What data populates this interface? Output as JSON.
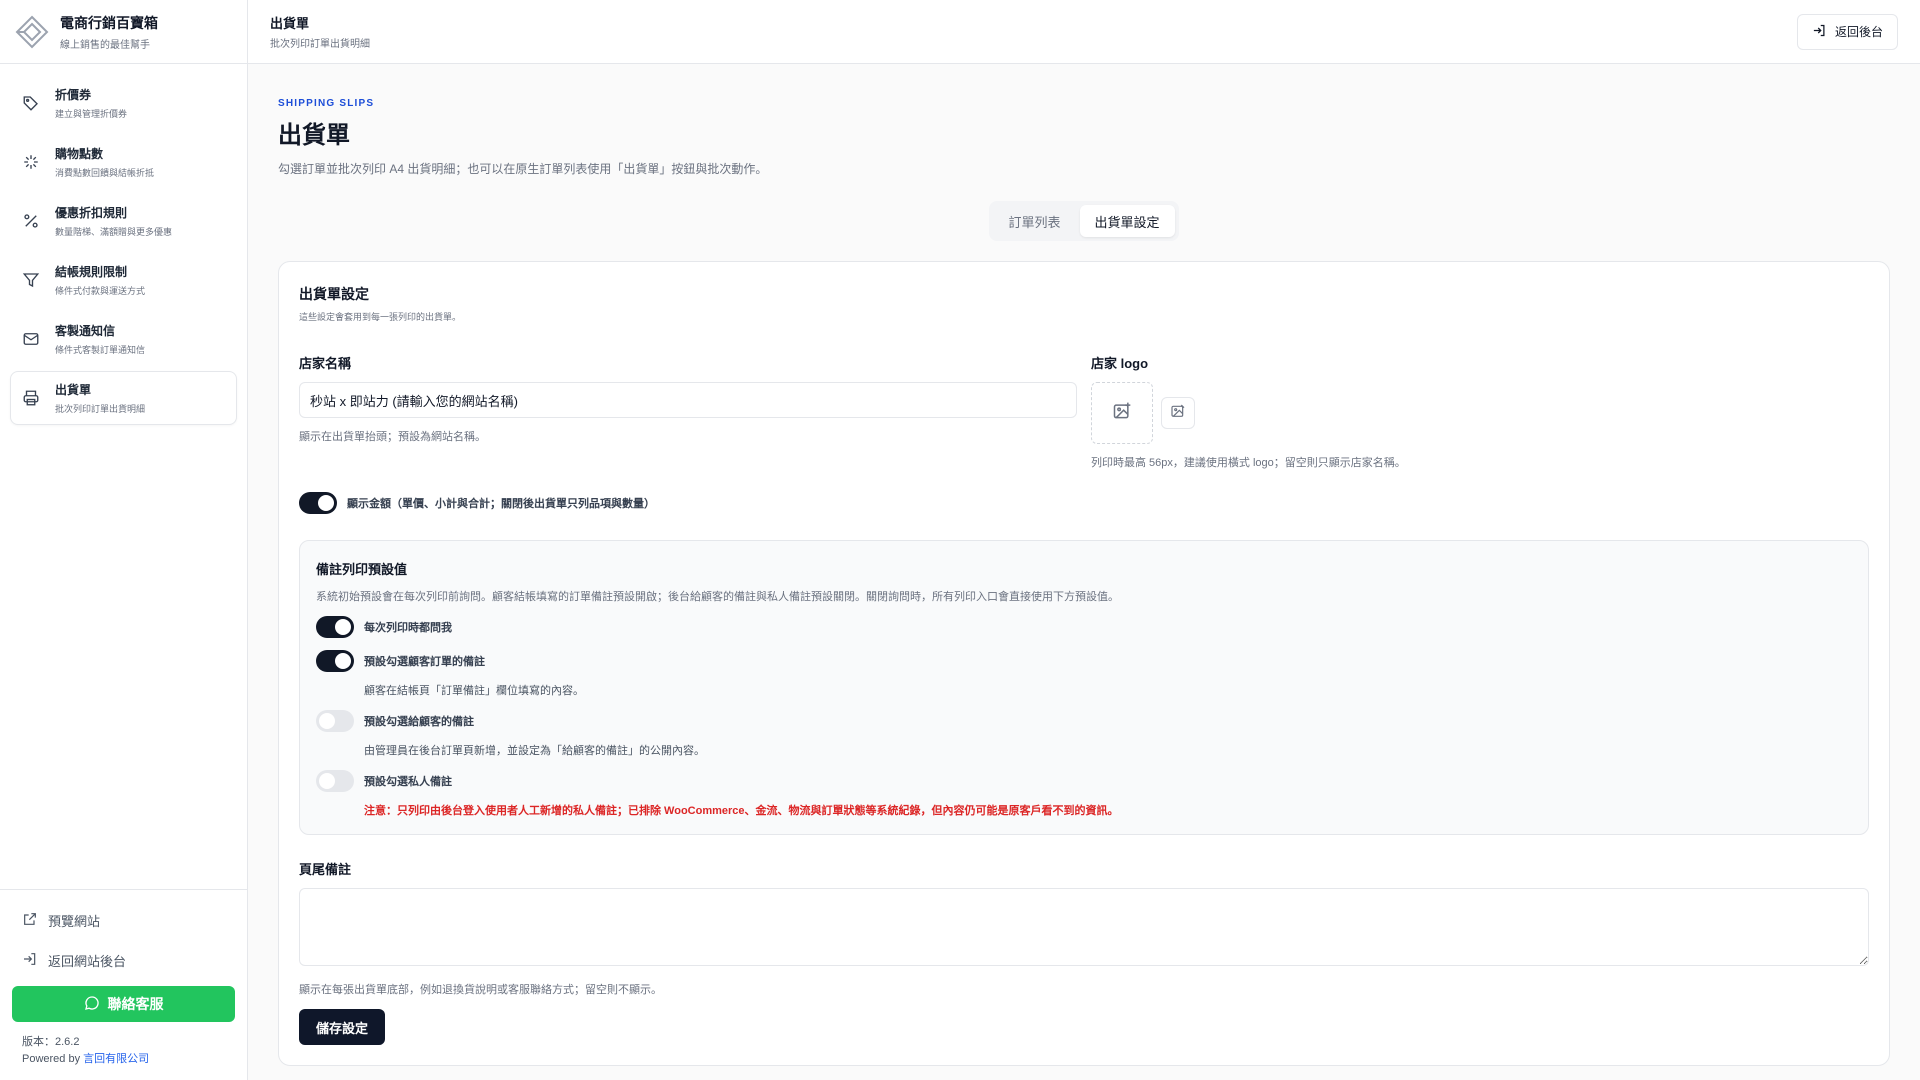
{
  "brand": {
    "title": "電商行銷百寶箱",
    "subtitle": "線上銷售的最佳幫手"
  },
  "sidebar": {
    "items": [
      {
        "icon": "tag-icon",
        "title": "折價券",
        "desc": "建立與管理折價券"
      },
      {
        "icon": "sparkle-icon",
        "title": "購物點數",
        "desc": "消費點數回饋與結帳折抵"
      },
      {
        "icon": "percent-icon",
        "title": "優惠折扣規則",
        "desc": "數量階梯、滿額贈與更多優惠"
      },
      {
        "icon": "filter-icon",
        "title": "結帳規則限制",
        "desc": "條件式付款與運送方式"
      },
      {
        "icon": "mail-icon",
        "title": "客製通知信",
        "desc": "條件式客製訂單通知信"
      },
      {
        "icon": "printer-icon",
        "title": "出貨單",
        "desc": "批次列印訂單出貨明細"
      }
    ],
    "preview_site": "預覽網站",
    "back_to_admin": "返回網站後台",
    "contact": "聯絡客服",
    "version": "版本：2.6.2",
    "powered_by": "Powered by",
    "company": "言回有限公司"
  },
  "topbar": {
    "title": "出貨單",
    "subtitle": "批次列印訂單出貨明細",
    "back_button": "返回後台"
  },
  "page": {
    "eyebrow": "SHIPPING SLIPS",
    "title": "出貨單",
    "desc": "勾選訂單並批次列印 A4 出貨明細；也可以在原生訂單列表使用「出貨單」按鈕與批次動作。"
  },
  "tabs": [
    {
      "label": "訂單列表",
      "active": false
    },
    {
      "label": "出貨單設定",
      "active": true
    }
  ],
  "settings": {
    "title": "出貨單設定",
    "desc": "這些設定會套用到每一張列印的出貨單。",
    "store_name_label": "店家名稱",
    "store_name_value": "秒站 x 即站力 (請輸入您的網站名稱)",
    "store_name_hint": "顯示在出貨單抬頭；預設為網站名稱。",
    "logo_label": "店家 logo",
    "logo_hint": "列印時最高 56px，建議使用橫式 logo；留空則只顯示店家名稱。",
    "show_amount_label": "顯示金額（單價、小計與合計；關閉後出貨單只列品項與數量）",
    "show_amount_on": true
  },
  "notes": {
    "title": "備註列印預設值",
    "desc": "系統初始預設會在每次列印前詢問。顧客結帳填寫的訂單備註預設開啟；後台給顧客的備註與私人備註預設關閉。關閉詢問時，所有列印入口會直接使用下方預設值。",
    "options": [
      {
        "label": "每次列印時都問我",
        "on": true,
        "desc": ""
      },
      {
        "label": "預設勾選顧客訂單的備註",
        "on": true,
        "desc": "顧客在結帳頁「訂單備註」欄位填寫的內容。"
      },
      {
        "label": "預設勾選給顧客的備註",
        "on": false,
        "desc": "由管理員在後台訂單頁新增，並設定為「給顧客的備註」的公開內容。"
      },
      {
        "label": "預設勾選私人備註",
        "on": false,
        "desc": ""
      }
    ],
    "warning": "注意：只列印由後台登入使用者人工新增的私人備註；已排除 WooCommerce、金流、物流與訂單狀態等系統紀錄，但內容仍可能是原客戶看不到的資訊。"
  },
  "footer_note": {
    "label": "頁尾備註",
    "value": "",
    "hint": "顯示在每張出貨單底部，例如退換貨說明或客服聯絡方式；留空則不顯示。"
  },
  "save_button": "儲存設定",
  "colors": {
    "accent": "#1d4ed8",
    "contact": "#22c55e",
    "dark": "#0f172a",
    "warning": "#dc2626"
  }
}
